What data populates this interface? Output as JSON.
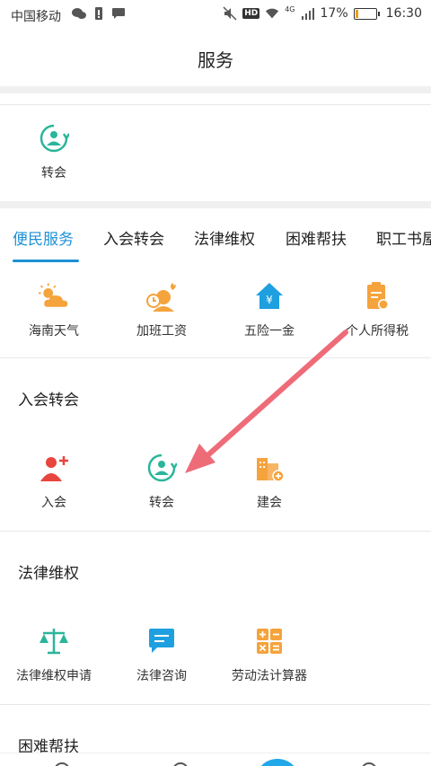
{
  "status_bar": {
    "carrier": "中国移动",
    "network": "4G",
    "battery_text": "17%",
    "battery_level": 0.17,
    "time": "16:30",
    "hd_label": "HD"
  },
  "header": {
    "title": "服务"
  },
  "recent": {
    "items": [
      {
        "label": "转会",
        "icon": "transfer-membership-icon"
      }
    ]
  },
  "tabs": [
    {
      "label": "便民服务",
      "active": true
    },
    {
      "label": "入会转会",
      "active": false
    },
    {
      "label": "法律维权",
      "active": false
    },
    {
      "label": "困难帮扶",
      "active": false
    },
    {
      "label": "职工书屋",
      "active": false
    }
  ],
  "convenience": {
    "items": [
      {
        "label": "海南天气",
        "icon": "weather-icon"
      },
      {
        "label": "加班工资",
        "icon": "overtime-pay-icon"
      },
      {
        "label": "五险一金",
        "icon": "insurance-fund-icon"
      },
      {
        "label": "个人所得税",
        "icon": "income-tax-icon"
      }
    ]
  },
  "join_transfer": {
    "title": "入会转会",
    "items": [
      {
        "label": "入会",
        "icon": "join-union-icon"
      },
      {
        "label": "转会",
        "icon": "transfer-membership-icon"
      },
      {
        "label": "建会",
        "icon": "build-union-icon"
      }
    ]
  },
  "legal_rights": {
    "title": "法律维权",
    "items": [
      {
        "label": "法律维权申请",
        "icon": "scales-icon"
      },
      {
        "label": "法律咨询",
        "icon": "chat-bubble-icon"
      },
      {
        "label": "劳动法计算器",
        "icon": "calculator-icon"
      }
    ]
  },
  "hardship": {
    "title": "困难帮扶"
  },
  "colors": {
    "accent": "#1e90d6",
    "teal": "#2bb59a",
    "orange": "#f5a33c",
    "red": "#e8453c",
    "blue_icon": "#1e9fe0",
    "arrow": "#ee6b78"
  }
}
